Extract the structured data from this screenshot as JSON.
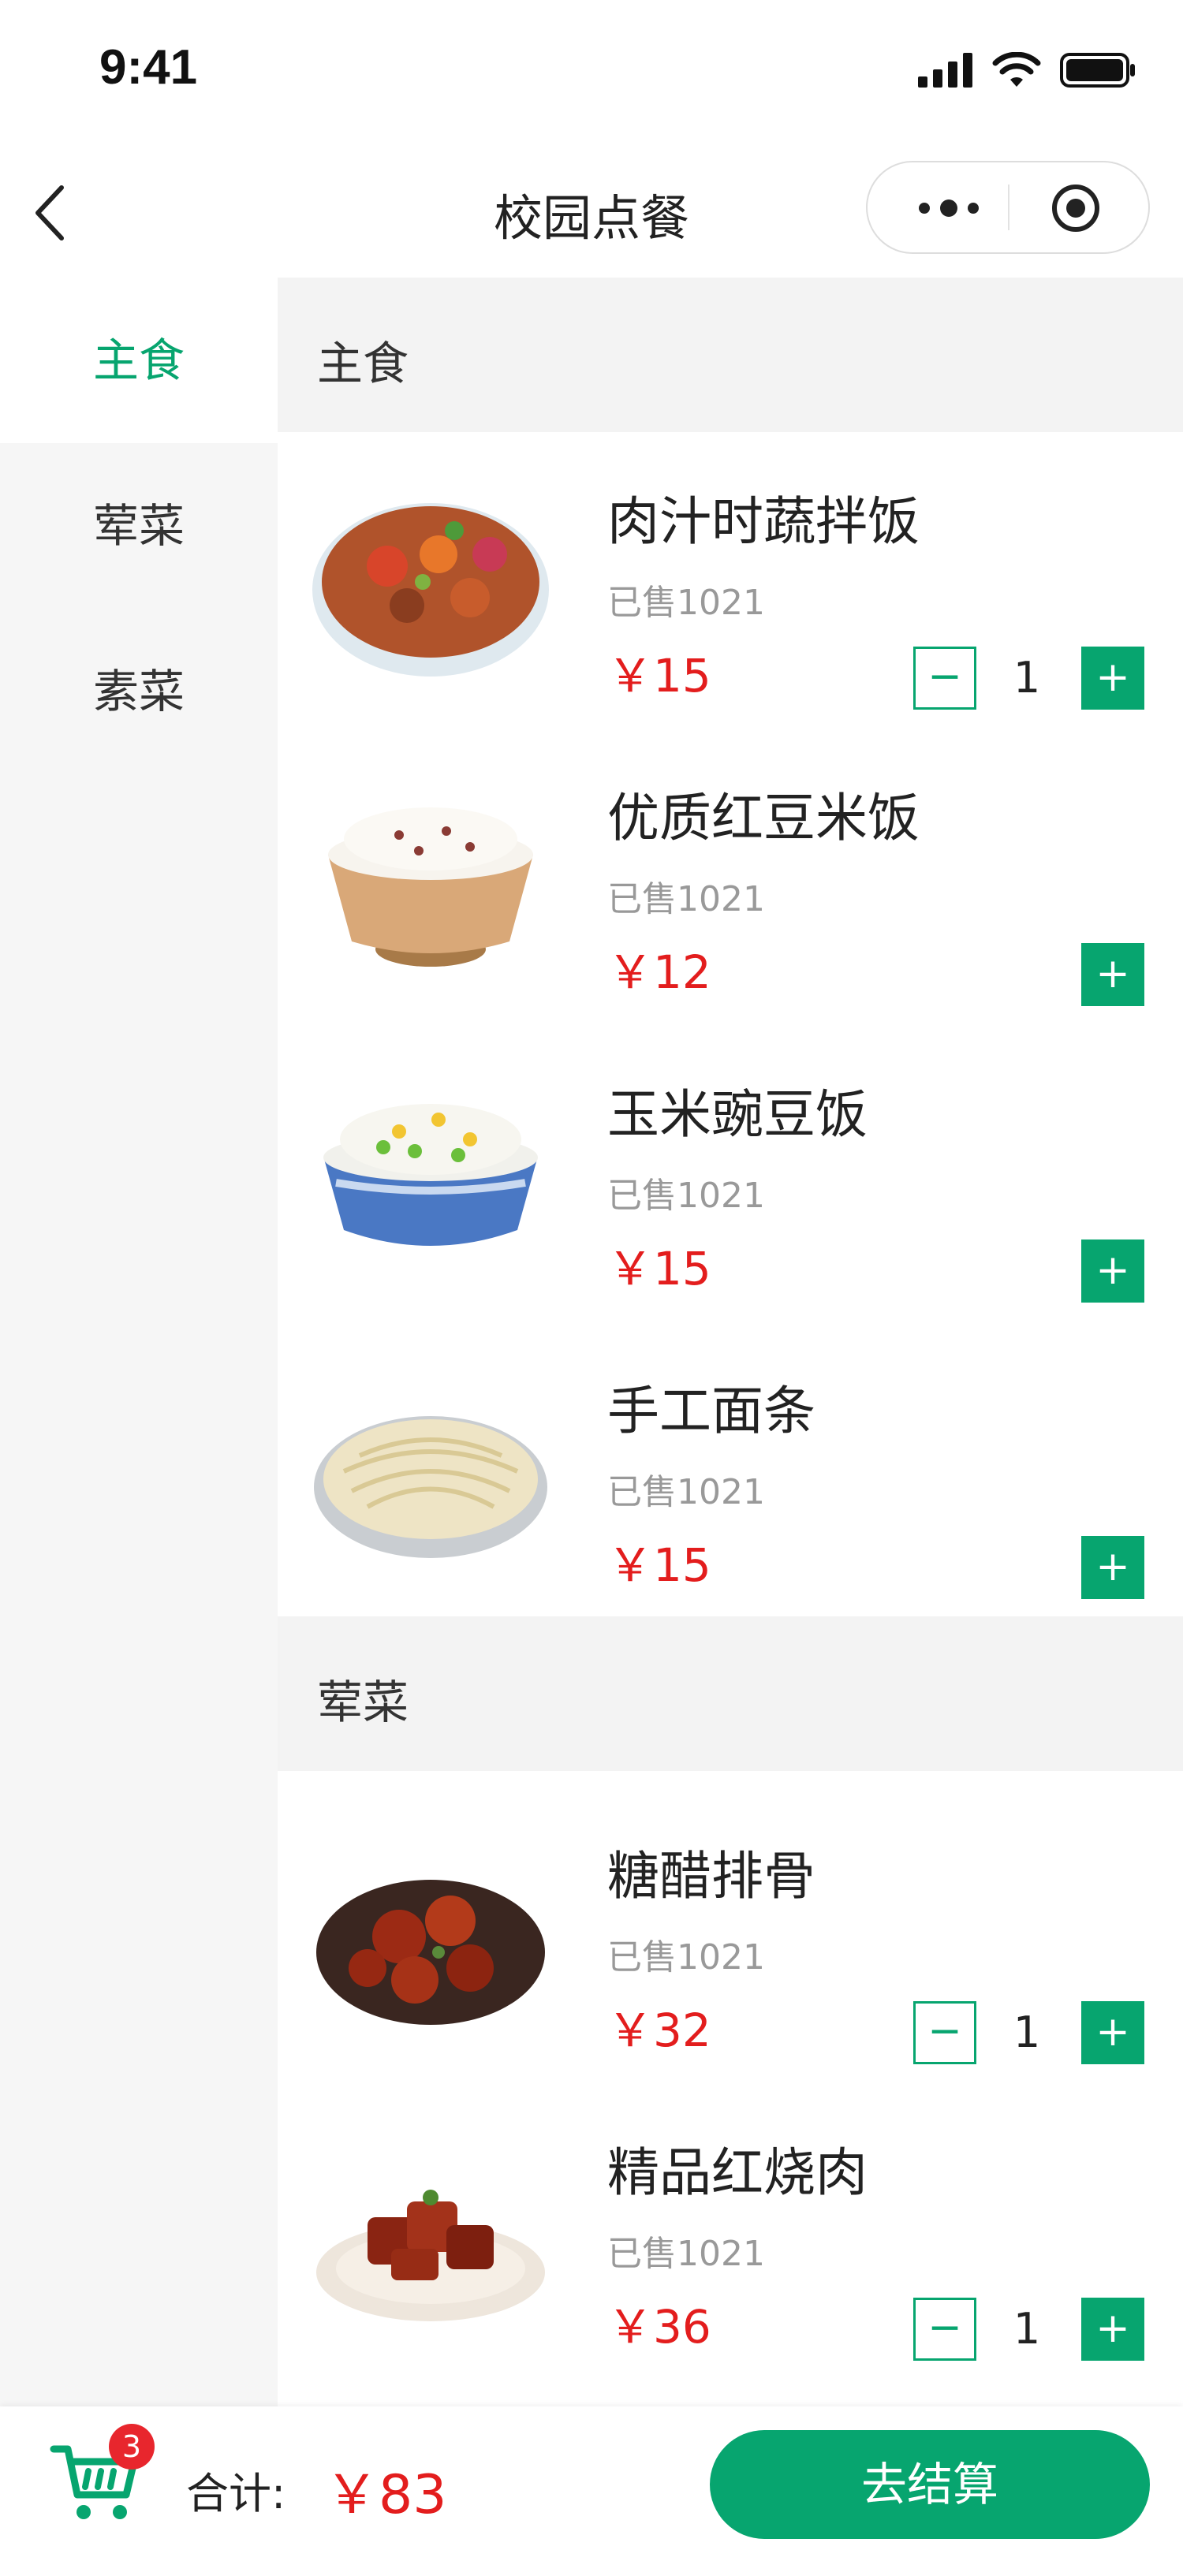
{
  "status": {
    "time": "9:41"
  },
  "nav": {
    "title": "校园点餐"
  },
  "sidebar": {
    "items": [
      {
        "label": "主食",
        "active": true
      },
      {
        "label": "荤菜",
        "active": false
      },
      {
        "label": "素菜",
        "active": false
      }
    ]
  },
  "sections": [
    {
      "title": "主食",
      "items": [
        {
          "name": "肉汁时蔬拌饭",
          "sold": "已售1021",
          "price": "￥15",
          "qty": "1",
          "minus": "−",
          "plus": "+"
        },
        {
          "name": "优质红豆米饭",
          "sold": "已售1021",
          "price": "￥12",
          "plus": "+"
        },
        {
          "name": "玉米豌豆饭",
          "sold": "已售1021",
          "price": "￥15",
          "plus": "+"
        },
        {
          "name": "手工面条",
          "sold": "已售1021",
          "price": "￥15",
          "plus": "+"
        }
      ]
    },
    {
      "title": "荤菜",
      "items": [
        {
          "name": "糖醋排骨",
          "sold": "已售1021",
          "price": "￥32",
          "qty": "1",
          "minus": "−",
          "plus": "+"
        },
        {
          "name": "精品红烧肉",
          "sold": "已售1021",
          "price": "￥36",
          "qty": "1",
          "minus": "−",
          "plus": "+"
        }
      ]
    }
  ],
  "cart": {
    "badge": "3",
    "total_label": "合计:",
    "total_value": "￥83",
    "checkout_label": "去结算"
  },
  "colors": {
    "accent": "#07a56f",
    "price": "#e31d1d",
    "badge": "#e8262d"
  },
  "icons": [
    "signal-icon",
    "wifi-icon",
    "battery-icon",
    "back-arrow-icon",
    "more-dots-icon",
    "target-icon",
    "cart-icon"
  ]
}
